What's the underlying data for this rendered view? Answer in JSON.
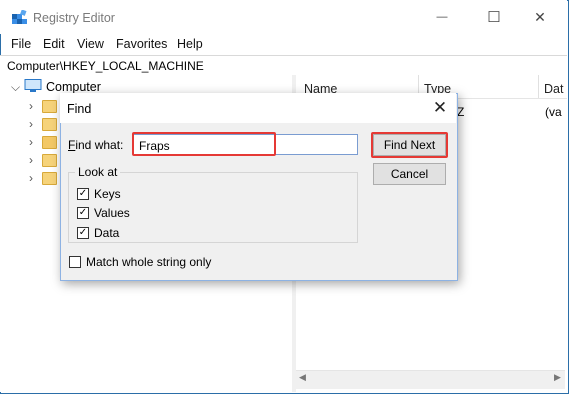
{
  "window": {
    "title": "Registry Editor",
    "minimize_glyph": "—",
    "maximize_glyph": "☐",
    "close_glyph": "✕"
  },
  "menu": {
    "items": [
      "File",
      "Edit",
      "View",
      "Favorites",
      "Help"
    ]
  },
  "address": {
    "path": "Computer\\HKEY_LOCAL_MACHINE"
  },
  "tree": {
    "root_label": "Computer"
  },
  "list": {
    "columns": [
      "Name",
      "Type",
      "Dat"
    ],
    "row_type_fragment": "Z",
    "row_data_fragment": "(va"
  },
  "find_dialog": {
    "title": "Find",
    "find_what_label": "Find what:",
    "find_what_value": "Fraps",
    "find_next_label": "Find Next",
    "cancel_label": "Cancel",
    "look_at_label": "Look at",
    "options": [
      {
        "label": "Keys",
        "checked": true
      },
      {
        "label": "Values",
        "checked": true
      },
      {
        "label": "Data",
        "checked": true
      }
    ],
    "match_whole_label": "Match whole string only",
    "match_whole_checked": false
  },
  "colors": {
    "highlight": "#e53935",
    "accent": "#0078d7"
  },
  "icons": [
    "registry-app-icon",
    "computer-icon",
    "folder-icon",
    "chevron-right-icon",
    "chevron-down-icon",
    "close-icon",
    "checkbox-icon"
  ]
}
